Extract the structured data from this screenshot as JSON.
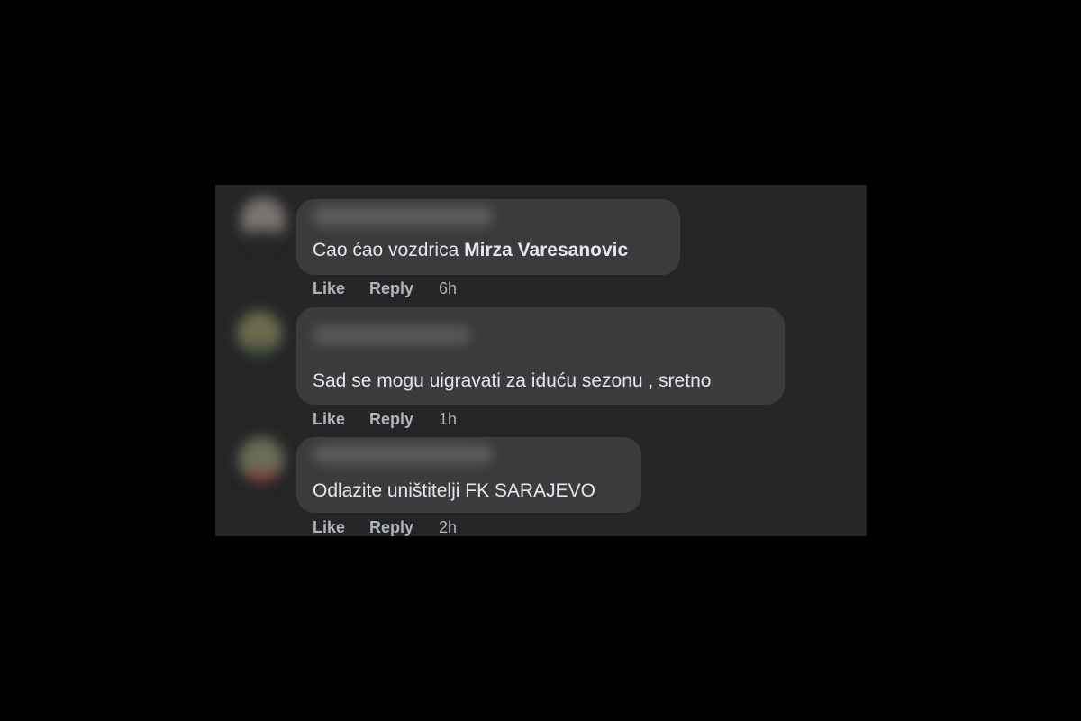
{
  "comments": [
    {
      "text": "Cao ćao vozdrica ",
      "mention": "Mirza Varesanovic",
      "like_label": "Like",
      "reply_label": "Reply",
      "time": "6h"
    },
    {
      "text": "Sad se mogu uigravati za iduću sezonu , sretno",
      "like_label": "Like",
      "reply_label": "Reply",
      "time": "1h"
    },
    {
      "text": "Odlazite uništitelji FK SARAJEVO",
      "like_label": "Like",
      "reply_label": "Reply",
      "time": "2h"
    }
  ]
}
